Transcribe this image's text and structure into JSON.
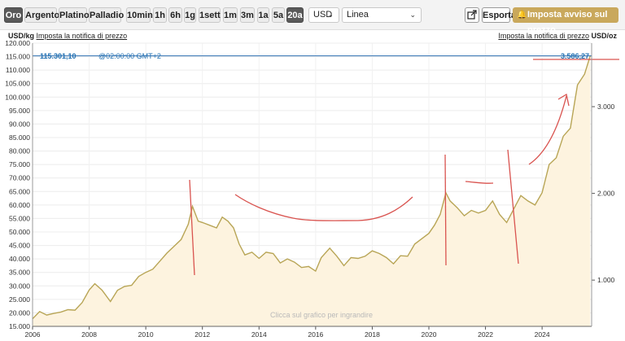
{
  "toolbar": {
    "metals": [
      "Oro",
      "Argento",
      "Platino",
      "Palladio"
    ],
    "ranges": [
      "10min",
      "1h",
      "6h",
      "1g",
      "1sett",
      "1m",
      "3m",
      "1a",
      "5a",
      "20a"
    ],
    "active_metal": "Oro",
    "active_range": "20a",
    "currency": "USD",
    "chart_style": "Linea",
    "export_label": "Esporta",
    "alert_label": "Imposta avviso sul prezzo",
    "accent_color": "#c9a85c"
  },
  "header": {
    "left_unit": "USD/kg",
    "left_link": "Imposta la notifica di prezzo",
    "right_link": "Imposta la notifica di prezzo",
    "right_unit": "USD/oz"
  },
  "chart_data": {
    "type": "area",
    "xlabel": "",
    "ylabel": "",
    "x_ticks": [
      "2006",
      "2008",
      "2010",
      "2012",
      "2014",
      "2016",
      "2018",
      "2020",
      "2022",
      "2024"
    ],
    "x_range": [
      2006.0,
      2025.75
    ],
    "left_axis": {
      "unit": "USD/kg",
      "range": [
        15000,
        120000
      ],
      "ticks": [
        "120.000",
        "115.000",
        "110.000",
        "105.000",
        "100.000",
        "95.000",
        "90.000",
        "85.000",
        "80.000",
        "75.000",
        "70.000",
        "65.000",
        "60.000",
        "55.000",
        "50.000",
        "45.000",
        "40.000",
        "35.000",
        "30.000",
        "25.000",
        "20.000",
        "15.000"
      ]
    },
    "right_axis": {
      "unit": "USD/oz",
      "ticks": [
        "3.000",
        "2.000",
        "1.000"
      ]
    },
    "current_value_left": "115.301,10",
    "current_time": "@02:00:00 GMT+2",
    "current_value_right": "3.586,27",
    "current_line_value": 115301,
    "watermark": "Clicca sul grafico per ingrandire",
    "grid": true,
    "series": [
      {
        "line_color": "#b8a556",
        "fill_color": "#fdf3df",
        "points": [
          [
            2006.0,
            17800
          ],
          [
            2006.25,
            20500
          ],
          [
            2006.5,
            19200
          ],
          [
            2006.75,
            19800
          ],
          [
            2007.0,
            20300
          ],
          [
            2007.25,
            21200
          ],
          [
            2007.5,
            21000
          ],
          [
            2007.75,
            23800
          ],
          [
            2008.0,
            28500
          ],
          [
            2008.2,
            30800
          ],
          [
            2008.45,
            28500
          ],
          [
            2008.75,
            24200
          ],
          [
            2009.0,
            28400
          ],
          [
            2009.25,
            29800
          ],
          [
            2009.5,
            30200
          ],
          [
            2009.75,
            33500
          ],
          [
            2010.0,
            35000
          ],
          [
            2010.25,
            36200
          ],
          [
            2010.5,
            39200
          ],
          [
            2010.75,
            42200
          ],
          [
            2011.0,
            44700
          ],
          [
            2011.25,
            47200
          ],
          [
            2011.5,
            52800
          ],
          [
            2011.65,
            59500
          ],
          [
            2011.85,
            54000
          ],
          [
            2012.0,
            53500
          ],
          [
            2012.25,
            52500
          ],
          [
            2012.5,
            51500
          ],
          [
            2012.7,
            55500
          ],
          [
            2012.9,
            54000
          ],
          [
            2013.1,
            51500
          ],
          [
            2013.3,
            45500
          ],
          [
            2013.5,
            41500
          ],
          [
            2013.75,
            42500
          ],
          [
            2014.0,
            40200
          ],
          [
            2014.25,
            42500
          ],
          [
            2014.5,
            42000
          ],
          [
            2014.75,
            38500
          ],
          [
            2015.0,
            40000
          ],
          [
            2015.25,
            38800
          ],
          [
            2015.5,
            36800
          ],
          [
            2015.75,
            37200
          ],
          [
            2016.0,
            35500
          ],
          [
            2016.2,
            40500
          ],
          [
            2016.5,
            44000
          ],
          [
            2016.75,
            41000
          ],
          [
            2017.0,
            37500
          ],
          [
            2017.25,
            40500
          ],
          [
            2017.5,
            40200
          ],
          [
            2017.75,
            41000
          ],
          [
            2018.0,
            43000
          ],
          [
            2018.25,
            42000
          ],
          [
            2018.5,
            40500
          ],
          [
            2018.75,
            38200
          ],
          [
            2019.0,
            41200
          ],
          [
            2019.25,
            41000
          ],
          [
            2019.5,
            45500
          ],
          [
            2019.75,
            47500
          ],
          [
            2020.0,
            49500
          ],
          [
            2020.2,
            52500
          ],
          [
            2020.4,
            56500
          ],
          [
            2020.6,
            64500
          ],
          [
            2020.75,
            61500
          ],
          [
            2021.0,
            59000
          ],
          [
            2021.25,
            56000
          ],
          [
            2021.5,
            58000
          ],
          [
            2021.75,
            57000
          ],
          [
            2022.0,
            58000
          ],
          [
            2022.25,
            61500
          ],
          [
            2022.5,
            56500
          ],
          [
            2022.75,
            53500
          ],
          [
            2023.0,
            58500
          ],
          [
            2023.25,
            63500
          ],
          [
            2023.5,
            61500
          ],
          [
            2023.75,
            60000
          ],
          [
            2024.0,
            64500
          ],
          [
            2024.25,
            75000
          ],
          [
            2024.5,
            77500
          ],
          [
            2024.75,
            85500
          ],
          [
            2025.0,
            88500
          ],
          [
            2025.25,
            104500
          ],
          [
            2025.5,
            108500
          ],
          [
            2025.7,
            115300
          ]
        ]
      }
    ]
  }
}
